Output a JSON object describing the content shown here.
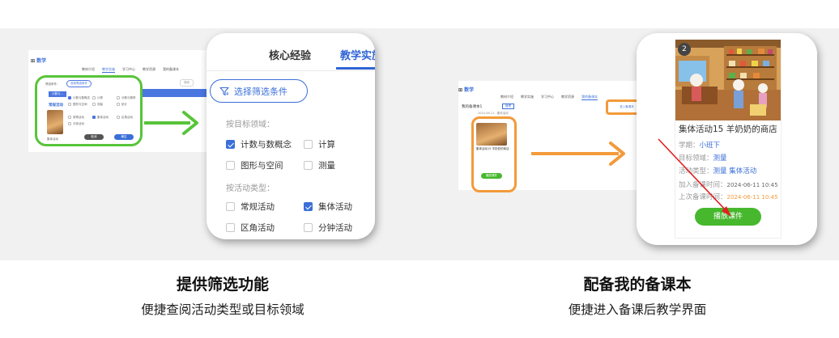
{
  "colors": {
    "green": "#58c43a",
    "orange": "#f39a3a",
    "blue": "#3b6fd8",
    "play": "#47b82e"
  },
  "left_mini": {
    "logo_icon": "ruler-icon",
    "logo": "数学",
    "nav": [
      "教材介绍",
      "教学实施",
      "学习中心",
      "教学资源",
      "我的备课本"
    ],
    "search_placeholder": "搜索",
    "filter_label": "筛选条件：",
    "filter_btn": "选择筛选条件",
    "tag": "计数与...",
    "section": "常规活动",
    "opts": [
      "计数与数概念",
      "计算",
      "分数与概率",
      "图形与空间",
      "测量",
      "统计",
      "常规活动",
      "集体活动",
      "区角活动",
      "分钟活动"
    ],
    "cancel": "取消",
    "confirm": "确定",
    "card_caption": "集体活动"
  },
  "zoom_left": {
    "tab_a": "核心经验",
    "tab_b": "教学实施",
    "filter_icon": "funnel-icon",
    "filter_button": "选择筛选条件",
    "section_goal": "按目标领域：",
    "goal_options": [
      {
        "label": "计数与数概念",
        "checked": true
      },
      {
        "label": "计算",
        "checked": false
      },
      {
        "label": "图形与空间",
        "checked": false
      },
      {
        "label": "测量",
        "checked": false
      }
    ],
    "section_type": "按活动类型：",
    "type_options": [
      {
        "label": "常规活动",
        "checked": false
      },
      {
        "label": "集体活动",
        "checked": true
      },
      {
        "label": "区角活动",
        "checked": false
      },
      {
        "label": "分钟活动",
        "checked": false
      }
    ]
  },
  "right_mini": {
    "logo": "数学",
    "nav": [
      "教材介绍",
      "教学实施",
      "学习中心",
      "教学资源",
      "我的备课本"
    ],
    "header": "我的备课本1",
    "edit": "管理",
    "crumb": "2024-06-11 · 集体活动",
    "prepare_btn": "进入备课本",
    "card_title": "集体活动15 羊奶奶的商店",
    "play": "播放课件"
  },
  "zoom_right": {
    "badge": "2",
    "title": "集体活动15 羊奶奶的商店",
    "term_label": "学期：",
    "term_value": "小班下",
    "domain_label": "目标领域：",
    "domain_value": "测量",
    "type_label": "活动类型：",
    "type_value_1": "测量",
    "type_value_2": "集体活动",
    "added_label": "加入备课时间：",
    "added_value": "2024-06-11 10:45",
    "last_label": "上次备课时间：",
    "last_value": "2024-06-11 10:45",
    "play_button": "播放课件"
  },
  "captions": {
    "left_title": "提供筛选功能",
    "left_sub": "便捷查阅活动类型或目标领域",
    "right_title": "配备我的备课本",
    "right_sub": "便捷进入备课后教学界面"
  }
}
